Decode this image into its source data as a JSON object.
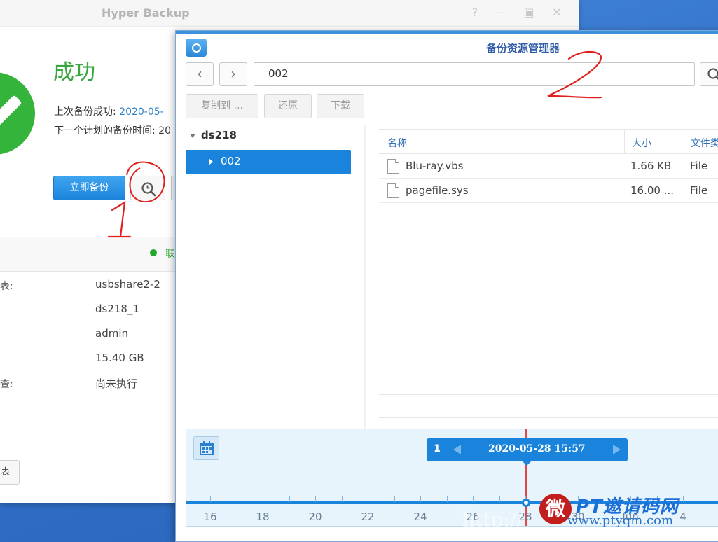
{
  "hyper_backup": {
    "title": "Hyper Backup",
    "status_title": "成功",
    "last_backup_label": "上次备份成功:",
    "last_backup_value": "2020-05-",
    "next_backup_label": "下一个计划的备份时间:",
    "next_backup_value": "20",
    "backup_now": "立即备份",
    "status_text": "联",
    "properties": [
      {
        "label": "表:",
        "value": "usbshare2-2"
      },
      {
        "label": "",
        "value": "ds218_1"
      },
      {
        "label": "",
        "value": "admin"
      },
      {
        "label": "",
        "value": "15.40 GB"
      },
      {
        "label": "查:",
        "value": "尚未执行"
      }
    ],
    "bottom_button": "表"
  },
  "explorer": {
    "title": "备份资源管理器",
    "path": "002",
    "actions": {
      "copy_to": "复制到 ...",
      "restore": "还原",
      "download": "下载"
    },
    "tree": {
      "root": "ds218",
      "selected": "002"
    },
    "columns": {
      "name": "名称",
      "size": "大小",
      "type": "文件类"
    },
    "files": [
      {
        "name": "Blu-ray.vbs",
        "size": "1.66 KB",
        "type": "File"
      },
      {
        "name": "pagefile.sys",
        "size": "16.00 ...",
        "type": "File"
      }
    ],
    "timeline": {
      "version_index": "1",
      "selected_time": "2020-05-28 15:57",
      "tick_labels": [
        "16",
        "18",
        "20",
        "22",
        "24",
        "26",
        "28",
        "30",
        "Jun",
        "4"
      ]
    }
  },
  "annotations": {
    "mark_1": "1",
    "mark_2": "2"
  },
  "watermark": {
    "logo": "微",
    "brand": "PT邀请码网",
    "url": "www.ptyqm.com",
    "faint": "http://"
  },
  "colors": {
    "accent": "#1a84dc",
    "success": "#34b43b",
    "annotation": "#e0201e",
    "timeline_marker": "#e04848"
  }
}
